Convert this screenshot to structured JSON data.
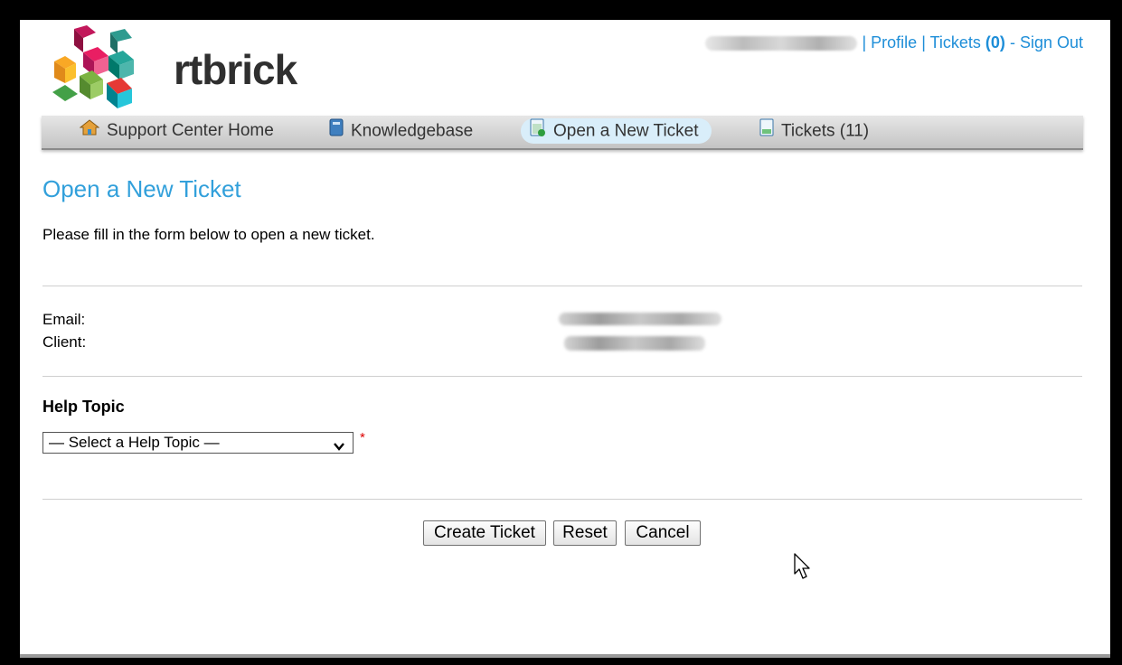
{
  "header": {
    "logo_text": "rtbrick",
    "profile_label": "Profile",
    "separator": "|",
    "tickets_label": "Tickets",
    "tickets_count": "(0)",
    "dash": "-",
    "signout_label": "Sign Out"
  },
  "nav": {
    "items": [
      {
        "label": "Support Center Home",
        "icon": "home-icon"
      },
      {
        "label": "Knowledgebase",
        "icon": "book-icon"
      },
      {
        "label": "Open a New Ticket",
        "icon": "new-ticket-icon"
      },
      {
        "label": "Tickets (11)",
        "icon": "tickets-icon"
      }
    ],
    "active_index": 2
  },
  "main": {
    "title": "Open a New Ticket",
    "intro": "Please fill in the form below to open a new ticket.",
    "email_label": "Email:",
    "client_label": "Client:",
    "help_topic_heading": "Help Topic",
    "help_topic_selected": "— Select a Help Topic —",
    "required_marker": "*"
  },
  "buttons": {
    "create": "Create Ticket",
    "reset": "Reset",
    "cancel": "Cancel"
  },
  "colors": {
    "link": "#1e8ed8",
    "title": "#32a0db",
    "required": "#dd0000",
    "nav_active": "#d9eefa"
  }
}
